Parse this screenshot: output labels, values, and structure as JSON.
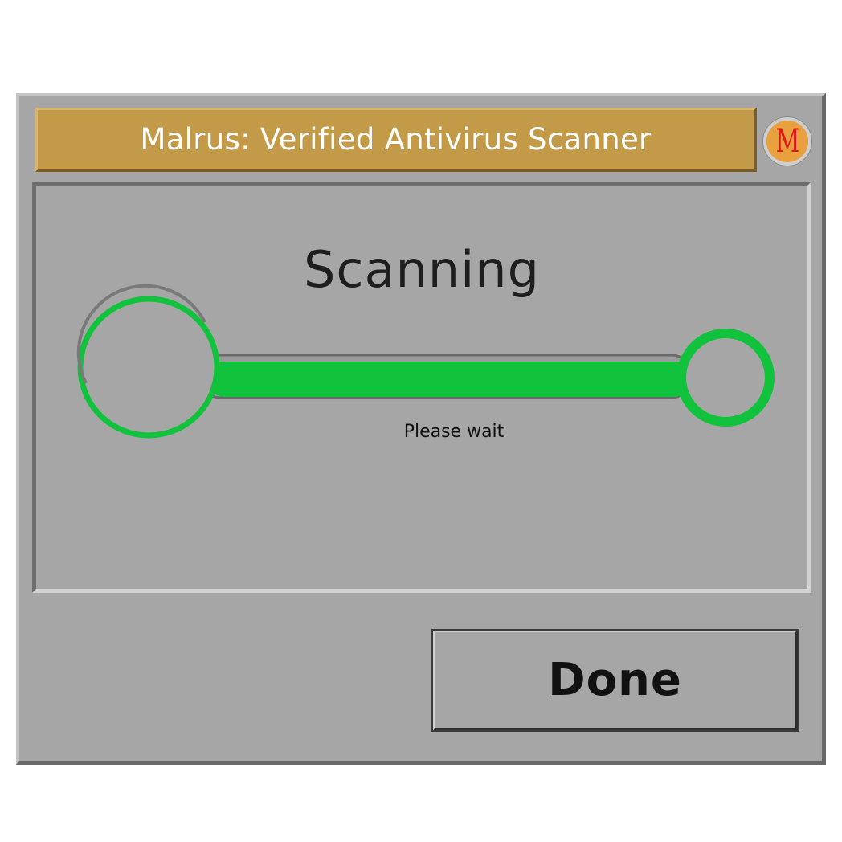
{
  "window": {
    "title": "Malrus: Verified Antivirus Scanner",
    "logo_letter": "M"
  },
  "scan": {
    "heading": "Scanning",
    "status": "Please wait",
    "progress_percent": 100
  },
  "buttons": {
    "done_label": "Done"
  },
  "colors": {
    "titlebar": "#c29a48",
    "progress": "#11c23c",
    "window": "#a6a6a6",
    "logo_bg": "#e8a13e",
    "logo_letter": "#e11818"
  }
}
